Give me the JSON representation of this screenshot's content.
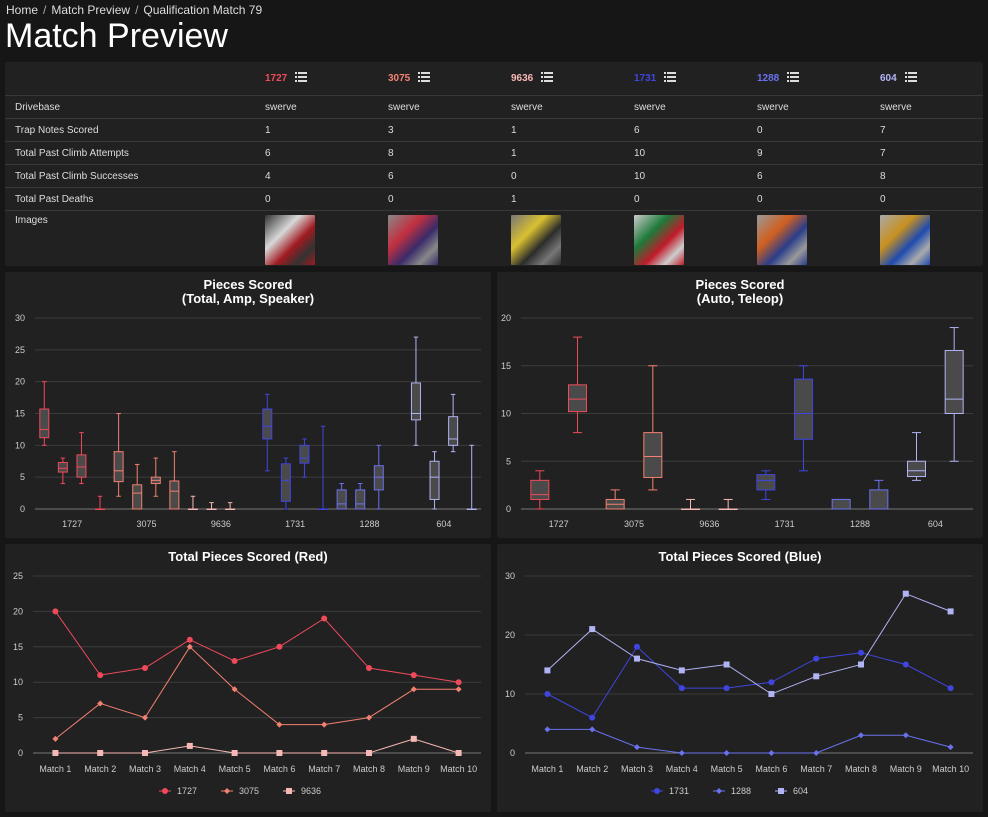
{
  "breadcrumb": [
    "Home",
    "Match Preview",
    "Qualification Match 79"
  ],
  "page_title": "Match Preview",
  "teams": [
    {
      "number": "1727",
      "color": "#ef4a5a",
      "alliance": "red"
    },
    {
      "number": "3075",
      "color": "#f38070",
      "alliance": "red"
    },
    {
      "number": "9636",
      "color": "#f5b8b5",
      "alliance": "red"
    },
    {
      "number": "1731",
      "color": "#3f46e0",
      "alliance": "blue"
    },
    {
      "number": "1288",
      "color": "#6a72f0",
      "alliance": "blue"
    },
    {
      "number": "604",
      "color": "#b0b3f4",
      "alliance": "blue"
    }
  ],
  "stats_rows": [
    {
      "label": "Drivebase",
      "values": [
        "swerve",
        "swerve",
        "swerve",
        "swerve",
        "swerve",
        "swerve"
      ]
    },
    {
      "label": "Trap Notes Scored",
      "values": [
        "1",
        "3",
        "1",
        "6",
        "0",
        "7"
      ]
    },
    {
      "label": "Total Past Climb Attempts",
      "values": [
        "6",
        "8",
        "1",
        "10",
        "9",
        "7"
      ]
    },
    {
      "label": "Total Past Climb Successes",
      "values": [
        "4",
        "6",
        "0",
        "10",
        "6",
        "8"
      ]
    },
    {
      "label": "Total Past Deaths",
      "values": [
        "0",
        "0",
        "1",
        "0",
        "0",
        "0"
      ]
    }
  ],
  "images_label": "Images",
  "image_colors": [
    [
      "#a01a20",
      "#d8d8d8",
      "#333"
    ],
    [
      "#3a2b6a",
      "#c23040",
      "#888"
    ],
    [
      "#2c2c2c",
      "#d8c030",
      "#777"
    ],
    [
      "#c01b2a",
      "#1e7a3a",
      "#ccc"
    ],
    [
      "#2a3d8a",
      "#d06020",
      "#999"
    ],
    [
      "#1e4ab0",
      "#c89020",
      "#aaa"
    ]
  ],
  "chart_data": [
    {
      "type": "box",
      "title": "Pieces Scored",
      "subtitle": "(Total, Amp, Speaker)",
      "categories": [
        "1727",
        "3075",
        "9636",
        "1731",
        "1288",
        "604"
      ],
      "ylim": [
        0,
        30
      ],
      "yticks": [
        0,
        5,
        10,
        15,
        20,
        25,
        30
      ],
      "boxes": [
        {
          "team": 0,
          "slot": 0,
          "min": 10,
          "q1": 11.2,
          "median": 12.5,
          "q3": 15.7,
          "max": 20
        },
        {
          "team": 0,
          "slot": 1,
          "min": 4,
          "q1": 5.8,
          "median": 6.4,
          "q3": 7.3,
          "max": 8
        },
        {
          "team": 0,
          "slot": 2,
          "min": 4,
          "q1": 5,
          "median": 6.6,
          "q3": 8.5,
          "max": 12
        },
        {
          "team": 0,
          "slot": 3,
          "min": 0,
          "q1": 0,
          "median": 0,
          "q3": 0,
          "max": 2
        },
        {
          "team": 1,
          "slot": 0,
          "min": 2,
          "q1": 4.3,
          "median": 6,
          "q3": 9,
          "max": 15
        },
        {
          "team": 1,
          "slot": 1,
          "min": 0,
          "q1": 0,
          "median": 2.5,
          "q3": 3.8,
          "max": 7
        },
        {
          "team": 1,
          "slot": 2,
          "min": 2,
          "q1": 4,
          "median": 4.5,
          "q3": 5,
          "max": 8
        },
        {
          "team": 1,
          "slot": 3,
          "min": 0,
          "q1": 0,
          "median": 2.8,
          "q3": 4.4,
          "max": 9
        },
        {
          "team": 2,
          "slot": 0,
          "min": 0,
          "q1": 0,
          "median": 0,
          "q3": 0,
          "max": 2
        },
        {
          "team": 2,
          "slot": 1,
          "min": 0,
          "q1": 0,
          "median": 0,
          "q3": 0,
          "max": 1
        },
        {
          "team": 2,
          "slot": 2,
          "min": 0,
          "q1": 0,
          "median": 0,
          "q3": 0,
          "max": 1
        },
        {
          "team": 3,
          "slot": 0,
          "min": 6,
          "q1": 11,
          "median": 13,
          "q3": 15.7,
          "max": 18
        },
        {
          "team": 3,
          "slot": 1,
          "min": 0,
          "q1": 1.2,
          "median": 4.5,
          "q3": 7.1,
          "max": 8
        },
        {
          "team": 3,
          "slot": 2,
          "min": 5,
          "q1": 7.2,
          "median": 8,
          "q3": 10,
          "max": 11
        },
        {
          "team": 3,
          "slot": 3,
          "min": 0,
          "q1": 0,
          "median": 0,
          "q3": 0,
          "max": 13
        },
        {
          "team": 4,
          "slot": 0,
          "min": 0,
          "q1": 0,
          "median": 0.8,
          "q3": 3,
          "max": 4
        },
        {
          "team": 4,
          "slot": 1,
          "min": 0,
          "q1": 0,
          "median": 0.8,
          "q3": 3,
          "max": 4
        },
        {
          "team": 4,
          "slot": 2,
          "min": 0,
          "q1": 3,
          "median": 5,
          "q3": 6.8,
          "max": 10
        },
        {
          "team": 5,
          "slot": 0,
          "min": 10,
          "q1": 14,
          "median": 15,
          "q3": 19.8,
          "max": 27
        },
        {
          "team": 5,
          "slot": 1,
          "min": 0,
          "q1": 1.5,
          "median": 5,
          "q3": 7.5,
          "max": 9
        },
        {
          "team": 5,
          "slot": 2,
          "min": 9,
          "q1": 10,
          "median": 11,
          "q3": 14.5,
          "max": 18
        },
        {
          "team": 5,
          "slot": 3,
          "min": 0,
          "q1": 0,
          "median": 0,
          "q3": 0,
          "max": 10
        }
      ]
    },
    {
      "type": "box",
      "title": "Pieces Scored",
      "subtitle": "(Auto, Teleop)",
      "categories": [
        "1727",
        "3075",
        "9636",
        "1731",
        "1288",
        "604"
      ],
      "ylim": [
        0,
        20
      ],
      "yticks": [
        0,
        5,
        10,
        15,
        20
      ],
      "boxes": [
        {
          "team": 0,
          "slot": 0,
          "min": 0,
          "q1": 1,
          "median": 1.5,
          "q3": 3,
          "max": 4
        },
        {
          "team": 0,
          "slot": 1,
          "min": 8,
          "q1": 10.2,
          "median": 11.5,
          "q3": 13,
          "max": 18
        },
        {
          "team": 1,
          "slot": 0,
          "min": 0,
          "q1": 0,
          "median": 0.5,
          "q3": 1,
          "max": 2
        },
        {
          "team": 1,
          "slot": 1,
          "min": 2,
          "q1": 3.3,
          "median": 5.5,
          "q3": 8,
          "max": 15
        },
        {
          "team": 2,
          "slot": 0,
          "min": 0,
          "q1": 0,
          "median": 0,
          "q3": 0,
          "max": 1
        },
        {
          "team": 2,
          "slot": 1,
          "min": 0,
          "q1": 0,
          "median": 0,
          "q3": 0,
          "max": 1
        },
        {
          "team": 3,
          "slot": 0,
          "min": 1,
          "q1": 2,
          "median": 3,
          "q3": 3.6,
          "max": 4
        },
        {
          "team": 3,
          "slot": 1,
          "min": 4,
          "q1": 7.3,
          "median": 10,
          "q3": 13.6,
          "max": 15
        },
        {
          "team": 4,
          "slot": 0,
          "min": 0,
          "q1": 0,
          "median": 0,
          "q3": 1,
          "max": 1
        },
        {
          "team": 4,
          "slot": 1,
          "min": 0,
          "q1": 0,
          "median": 0,
          "q3": 2,
          "max": 3
        },
        {
          "team": 5,
          "slot": 0,
          "min": 3,
          "q1": 3.4,
          "median": 4,
          "q3": 5,
          "max": 8
        },
        {
          "team": 5,
          "slot": 1,
          "min": 5,
          "q1": 10,
          "median": 11.5,
          "q3": 16.6,
          "max": 19
        }
      ]
    },
    {
      "type": "line",
      "title": "Total Pieces Scored (Red)",
      "categories": [
        "Match 1",
        "Match 2",
        "Match 3",
        "Match 4",
        "Match 5",
        "Match 6",
        "Match 7",
        "Match 8",
        "Match 9",
        "Match 10"
      ],
      "ylim": [
        0,
        25
      ],
      "yticks": [
        0,
        5,
        10,
        15,
        20,
        25
      ],
      "series": [
        {
          "name": "1727",
          "color": "#ef4a5a",
          "marker": "circle",
          "values": [
            20,
            11,
            12,
            16,
            13,
            15,
            19,
            12,
            11,
            10
          ]
        },
        {
          "name": "3075",
          "color": "#f38070",
          "marker": "diamond",
          "values": [
            2,
            7,
            5,
            15,
            9,
            4,
            4,
            5,
            9,
            9
          ]
        },
        {
          "name": "9636",
          "color": "#f5b8b5",
          "marker": "square",
          "values": [
            0,
            0,
            0,
            1,
            0,
            0,
            0,
            0,
            2,
            0
          ]
        }
      ]
    },
    {
      "type": "line",
      "title": "Total Pieces Scored (Blue)",
      "categories": [
        "Match 1",
        "Match 2",
        "Match 3",
        "Match 4",
        "Match 5",
        "Match 6",
        "Match 7",
        "Match 8",
        "Match 9",
        "Match 10"
      ],
      "ylim": [
        0,
        30
      ],
      "yticks": [
        0,
        10,
        20,
        30
      ],
      "series": [
        {
          "name": "1731",
          "color": "#3f46e0",
          "marker": "circle",
          "values": [
            10,
            6,
            18,
            11,
            11,
            12,
            16,
            17,
            15,
            11
          ]
        },
        {
          "name": "1288",
          "color": "#6a72f0",
          "marker": "diamond",
          "values": [
            4,
            4,
            1,
            0,
            0,
            0,
            0,
            3,
            3,
            1
          ]
        },
        {
          "name": "604",
          "color": "#b0b3f4",
          "marker": "square",
          "values": [
            14,
            21,
            16,
            14,
            15,
            10,
            13,
            15,
            27,
            24
          ]
        }
      ]
    }
  ]
}
